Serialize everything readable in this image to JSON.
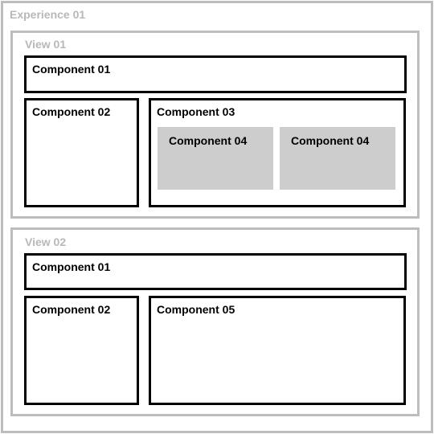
{
  "experience": {
    "title": "Experience 01"
  },
  "views": [
    {
      "title": "View 01",
      "components": {
        "c1": "Component 01",
        "c2": "Component 02",
        "c3": "Component 03",
        "c4a": "Component 04",
        "c4b": "Component 04"
      }
    },
    {
      "title": "View 02",
      "components": {
        "c1": "Component 01",
        "c2": "Component 02",
        "c5": "Component 05"
      }
    }
  ]
}
